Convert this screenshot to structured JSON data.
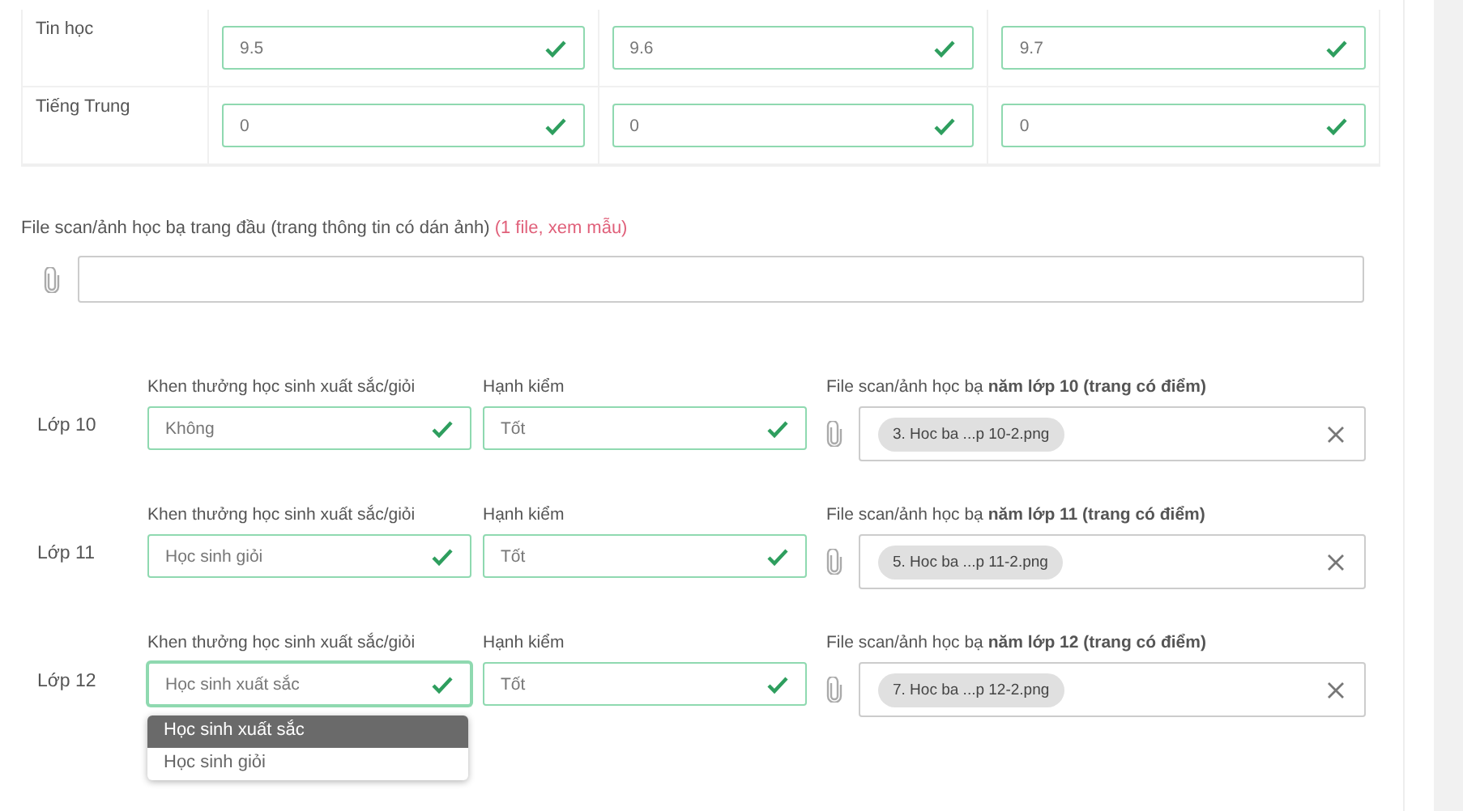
{
  "scores": {
    "rows": [
      {
        "subject": "Tin học",
        "cells": [
          {
            "value": "9.5",
            "valid": true
          },
          {
            "value": "9.6",
            "valid": true
          },
          {
            "value": "9.7",
            "valid": true
          }
        ]
      },
      {
        "subject": "Tiếng Trung",
        "cells": [
          {
            "value": "0",
            "valid": true
          },
          {
            "value": "0",
            "valid": true
          },
          {
            "value": "0",
            "valid": true
          }
        ]
      }
    ]
  },
  "first_page_file": {
    "label": "File scan/ảnh học bạ trang đầu (trang thông tin có dán ảnh)",
    "note": "(1 file, xem mẫu)"
  },
  "years": [
    {
      "label": "Lớp 10",
      "award": {
        "label": "Khen thưởng học sinh xuất sắc/giỏi",
        "value": "Không",
        "valid": true,
        "open": false
      },
      "conduct": {
        "label": "Hạnh kiểm",
        "value": "Tốt",
        "valid": true
      },
      "file": {
        "label": "File scan/ảnh học bạ **năm lớp 10 (trang có điểm)**",
        "chip": "3. Hoc ba ...p 10-2.png"
      }
    },
    {
      "label": "Lớp 11",
      "award": {
        "label": "Khen thưởng học sinh xuất sắc/giỏi",
        "value": "Học sinh giỏi",
        "valid": true,
        "open": false
      },
      "conduct": {
        "label": "Hạnh kiểm",
        "value": "Tốt",
        "valid": true
      },
      "file": {
        "label": "File scan/ảnh học bạ **năm lớp 11 (trang có điểm)**",
        "chip": "5. Hoc ba ...p 11-2.png"
      }
    },
    {
      "label": "Lớp 12",
      "award": {
        "label": "Khen thưởng học sinh xuất sắc/giỏi",
        "value": "Học sinh xuất sắc",
        "valid": true,
        "open": true
      },
      "conduct": {
        "label": "Hạnh kiểm",
        "value": "Tốt",
        "valid": true
      },
      "file": {
        "label": "File scan/ảnh học bạ **năm lớp 12 (trang có điểm)**",
        "chip": "7. Hoc ba ...p 12-2.png"
      }
    }
  ],
  "dropdown": {
    "options": [
      {
        "label": "Học sinh xuất sắc",
        "selected": true
      },
      {
        "label": "Học sinh giỏi",
        "selected": false
      }
    ]
  }
}
